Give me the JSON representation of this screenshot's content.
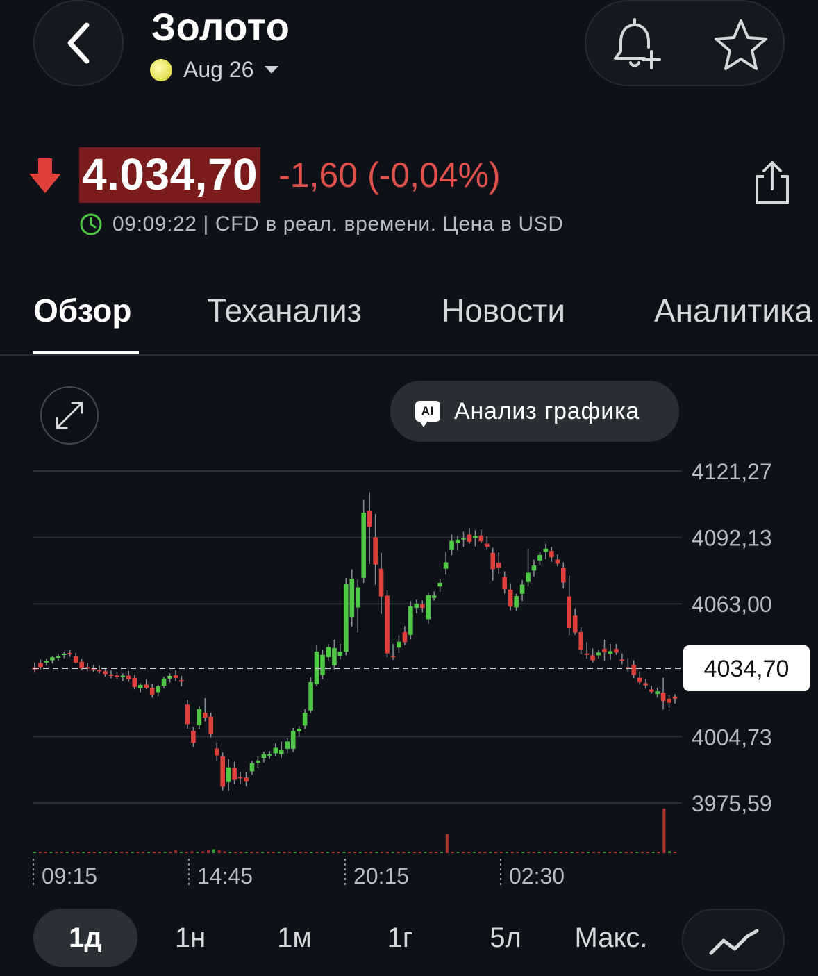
{
  "header": {
    "title": "Золото",
    "contract": "Aug 26",
    "colors": {
      "background": "#0e1117",
      "up": "#4fc945",
      "down": "#e0403b"
    }
  },
  "price": {
    "value": "4.034,70",
    "change": "-1,60 (-0,04%)",
    "direction": "down",
    "meta": "09:09:22 | CFD в реал. времени. Цена в USD"
  },
  "tabs": [
    {
      "label": "Обзор",
      "active": true
    },
    {
      "label": "Теханализ",
      "active": false
    },
    {
      "label": "Новости",
      "active": false
    },
    {
      "label": "Аналитика",
      "active": false
    }
  ],
  "ai_button": {
    "badge": "AI",
    "label": "Анализ графика"
  },
  "range_buttons": [
    {
      "label": "1д",
      "active": true
    },
    {
      "label": "1н",
      "active": false
    },
    {
      "label": "1м",
      "active": false
    },
    {
      "label": "1г",
      "active": false
    },
    {
      "label": "5л",
      "active": false
    },
    {
      "label": "Макс.",
      "active": false
    }
  ],
  "chart_data": {
    "type": "candlestick",
    "y_ticks": [
      "4121,27",
      "4092,13",
      "4063,00",
      "4034,70",
      "4004,73",
      "3975,59"
    ],
    "y_tick_values": [
      4121.27,
      4092.13,
      4063.0,
      4004.73,
      3975.59
    ],
    "ylim": [
      3975.59,
      4121.27
    ],
    "x_ticks": [
      "09:15",
      "14:45",
      "20:15",
      "02:30"
    ],
    "current_price": 4034.7,
    "current_label": "4034,70",
    "candles": [
      [
        4035.1,
        4037.2,
        4032.8,
        4034.2
      ],
      [
        4037.0,
        4038.5,
        4034.3,
        4035.2
      ],
      [
        4037.2,
        4039.0,
        4036.0,
        4037.8
      ],
      [
        4038.2,
        4040.1,
        4036.8,
        4039.5
      ],
      [
        4039.3,
        4041.0,
        4038.0,
        4040.2
      ],
      [
        4040.6,
        4042.0,
        4039.2,
        4041.1
      ],
      [
        4041.4,
        4042.6,
        4039.8,
        4040.9
      ],
      [
        4040.0,
        4041.5,
        4036.8,
        4037.2
      ],
      [
        4037.5,
        4038.8,
        4033.8,
        4034.6
      ],
      [
        4035.2,
        4037.0,
        4033.5,
        4034.8
      ],
      [
        4034.8,
        4036.2,
        4033.0,
        4034.0
      ],
      [
        4034.0,
        4035.8,
        4032.5,
        4033.4
      ],
      [
        4033.4,
        4034.6,
        4031.0,
        4032.2
      ],
      [
        4032.0,
        4033.8,
        4030.2,
        4031.6
      ],
      [
        4031.6,
        4033.2,
        4030.0,
        4030.8
      ],
      [
        4030.8,
        4032.4,
        4029.0,
        4031.5
      ],
      [
        4031.5,
        4033.5,
        4028.8,
        4030.0
      ],
      [
        4030.5,
        4031.8,
        4025.5,
        4026.5
      ],
      [
        4026.0,
        4028.2,
        4024.2,
        4027.4
      ],
      [
        4027.6,
        4029.8,
        4025.6,
        4026.1
      ],
      [
        4026.1,
        4028.0,
        4021.8,
        4023.2
      ],
      [
        4024.2,
        4027.5,
        4022.5,
        4026.8
      ],
      [
        4027.0,
        4031.0,
        4026.0,
        4030.2
      ],
      [
        4030.2,
        4032.5,
        4028.4,
        4031.4
      ],
      [
        4031.6,
        4034.0,
        4029.0,
        4030.5
      ],
      [
        4029.5,
        4031.4,
        4026.8,
        4028.8
      ],
      [
        4018.8,
        4021.0,
        4008.2,
        4010.2
      ],
      [
        4007.2,
        4009.0,
        4000.2,
        4002.0
      ],
      [
        4009.8,
        4018.0,
        4008.0,
        4016.8
      ],
      [
        4015.2,
        4021.6,
        4011.4,
        4013.0
      ],
      [
        4013.5,
        4015.2,
        4004.4,
        4006.0
      ],
      [
        3999.5,
        4002.2,
        3994.0,
        3996.5
      ],
      [
        3996.0,
        3997.8,
        3981.2,
        3982.8
      ],
      [
        3984.8,
        3994.8,
        3981.0,
        3991.2
      ],
      [
        3991.0,
        3993.6,
        3983.8,
        3985.8
      ],
      [
        3987.0,
        3989.2,
        3983.8,
        3986.8
      ],
      [
        3986.8,
        3989.0,
        3983.0,
        3985.0
      ],
      [
        3989.5,
        3994.2,
        3988.0,
        3993.0
      ],
      [
        3993.2,
        3996.0,
        3991.0,
        3994.2
      ],
      [
        3995.4,
        3998.2,
        3993.4,
        3997.0
      ],
      [
        3996.8,
        3998.4,
        3995.2,
        3997.0
      ],
      [
        3997.4,
        4001.8,
        3996.0,
        3999.8
      ],
      [
        3997.0,
        4002.6,
        3995.5,
        3998.8
      ],
      [
        3999.4,
        4004.0,
        3997.4,
        4002.6
      ],
      [
        3999.4,
        4008.5,
        3998.0,
        4007.2
      ],
      [
        4007.0,
        4009.4,
        4004.6,
        4008.2
      ],
      [
        4009.6,
        4016.8,
        4008.2,
        4015.2
      ],
      [
        4016.2,
        4030.8,
        4015.0,
        4028.6
      ],
      [
        4027.8,
        4045.0,
        4026.8,
        4042.0
      ],
      [
        4031.8,
        4042.8,
        4030.0,
        4040.6
      ],
      [
        4039.6,
        4045.4,
        4038.2,
        4044.0
      ],
      [
        4036.0,
        4047.2,
        4034.0,
        4043.6
      ],
      [
        4040.2,
        4045.4,
        4038.6,
        4042.0
      ],
      [
        4042.0,
        4074.4,
        4040.4,
        4071.8
      ],
      [
        4057.2,
        4078.2,
        4053.0,
        4074.0
      ],
      [
        4061.4,
        4073.6,
        4050.4,
        4070.2
      ],
      [
        4074.4,
        4108.6,
        4072.2,
        4103.0
      ],
      [
        4103.8,
        4112.0,
        4080.4,
        4096.8
      ],
      [
        4092.2,
        4102.4,
        4071.4,
        4080.2
      ],
      [
        4078.4,
        4085.4,
        4058.6,
        4066.2
      ],
      [
        4066.6,
        4069.0,
        4039.6,
        4041.2
      ],
      [
        4040.2,
        4045.4,
        4038.4,
        4039.6
      ],
      [
        4043.8,
        4049.2,
        4041.4,
        4046.4
      ],
      [
        4050.6,
        4053.2,
        4044.8,
        4046.2
      ],
      [
        4049.4,
        4064.2,
        4047.4,
        4062.0
      ],
      [
        4061.2,
        4064.8,
        4058.8,
        4063.0
      ],
      [
        4062.8,
        4064.4,
        4059.2,
        4061.2
      ],
      [
        4056.2,
        4068.0,
        4054.2,
        4066.8
      ],
      [
        4065.6,
        4068.4,
        4064.4,
        4066.6
      ],
      [
        4070.6,
        4074.0,
        4068.2,
        4072.2
      ],
      [
        4078.4,
        4085.8,
        4075.8,
        4081.2
      ],
      [
        4086.6,
        4093.4,
        4084.4,
        4090.6
      ],
      [
        4089.6,
        4092.8,
        4086.4,
        4091.2
      ],
      [
        4091.6,
        4094.6,
        4088.0,
        4091.8
      ],
      [
        4093.4,
        4096.2,
        4089.4,
        4090.2
      ],
      [
        4091.8,
        4095.2,
        4088.2,
        4092.8
      ],
      [
        4093.0,
        4095.6,
        4089.6,
        4090.4
      ],
      [
        4089.4,
        4092.6,
        4086.6,
        4088.0
      ],
      [
        4085.4,
        4087.6,
        4073.2,
        4078.2
      ],
      [
        4081.0,
        4085.6,
        4076.2,
        4078.8
      ],
      [
        4074.8,
        4077.2,
        4067.6,
        4069.4
      ],
      [
        4069.2,
        4072.0,
        4060.2,
        4061.8
      ],
      [
        4061.4,
        4067.4,
        4060.0,
        4066.4
      ],
      [
        4067.4,
        4073.4,
        4064.2,
        4071.4
      ],
      [
        4072.6,
        4087.0,
        4070.6,
        4076.6
      ],
      [
        4077.6,
        4082.4,
        4075.0,
        4079.8
      ],
      [
        4082.0,
        4085.8,
        4079.8,
        4084.4
      ],
      [
        4085.8,
        4089.4,
        4082.6,
        4087.2
      ],
      [
        4086.2,
        4088.0,
        4081.4,
        4083.4
      ],
      [
        4082.4,
        4084.6,
        4079.4,
        4080.6
      ],
      [
        4078.8,
        4081.2,
        4069.8,
        4072.4
      ],
      [
        4066.2,
        4075.4,
        4049.4,
        4052.4
      ],
      [
        4057.8,
        4061.0,
        4049.4,
        4050.4
      ],
      [
        4050.6,
        4052.6,
        4040.8,
        4042.8
      ],
      [
        4041.2,
        4046.2,
        4039.0,
        4040.6
      ],
      [
        4040.4,
        4043.4,
        4037.2,
        4038.2
      ],
      [
        4040.4,
        4042.8,
        4039.0,
        4041.6
      ],
      [
        4043.2,
        4047.2,
        4038.0,
        4041.8
      ],
      [
        4041.0,
        4045.4,
        4038.4,
        4042.2
      ],
      [
        4043.2,
        4045.4,
        4040.6,
        4041.6
      ],
      [
        4038.6,
        4041.2,
        4036.4,
        4037.8
      ],
      [
        4035.2,
        4039.2,
        4033.0,
        4034.6
      ],
      [
        4036.2,
        4038.2,
        4030.4,
        4031.8
      ],
      [
        4030.6,
        4033.4,
        4027.6,
        4028.6
      ],
      [
        4028.2,
        4030.0,
        4025.8,
        4027.2
      ],
      [
        4025.4,
        4027.0,
        4023.6,
        4024.4
      ],
      [
        4023.4,
        4026.2,
        4021.8,
        4024.6
      ],
      [
        4024.0,
        4030.6,
        4016.6,
        4020.4
      ],
      [
        4021.4,
        4022.8,
        4017.4,
        4019.6
      ],
      [
        4022.2,
        4023.4,
        4019.2,
        4021.4
      ]
    ],
    "volume": [
      1,
      1,
      1,
      1,
      1,
      1,
      1,
      1,
      1,
      1,
      1,
      1,
      1,
      1,
      1,
      1,
      1,
      1,
      1,
      1,
      1,
      1,
      1,
      2,
      1,
      2,
      4,
      2,
      2,
      3,
      2,
      3,
      4,
      6,
      4,
      3,
      2,
      1,
      1,
      1,
      1,
      1,
      1,
      1,
      1,
      1,
      1,
      1,
      2,
      2,
      2,
      1,
      1,
      1,
      1,
      1,
      1,
      1,
      1,
      1,
      1,
      1,
      1,
      1,
      1,
      1,
      1,
      1,
      1,
      1,
      1,
      1,
      1,
      1,
      1,
      1,
      30,
      1,
      1,
      1,
      1,
      1,
      1,
      1,
      1,
      1,
      1,
      1,
      1,
      1,
      1,
      1,
      1,
      1,
      1,
      1,
      1,
      1,
      1,
      1,
      1,
      1,
      1,
      1,
      1,
      1,
      1,
      1,
      1,
      1,
      1,
      1,
      1,
      1,
      1,
      1,
      70,
      3,
      2
    ]
  },
  "icons": {
    "back": "chevron-left-icon",
    "alert": "bell-plus-icon",
    "watchlist": "star-icon",
    "share": "share-icon",
    "clock": "clock-icon",
    "expand": "expand-icon",
    "chart_type": "line-chart-icon",
    "direction": "arrow-down-icon"
  }
}
